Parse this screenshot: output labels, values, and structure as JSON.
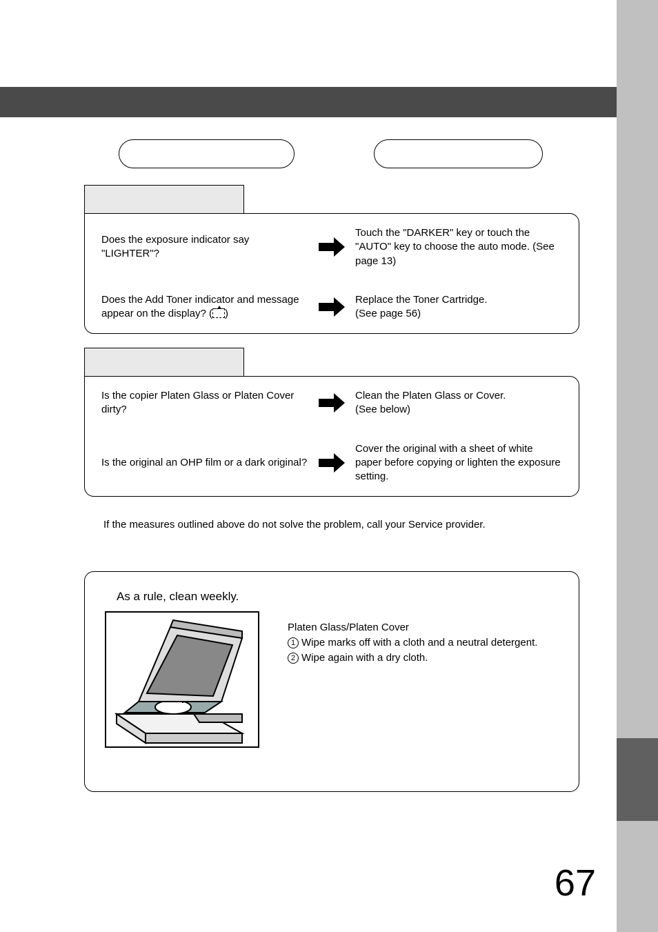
{
  "capsules": {
    "left_label": "",
    "right_label": ""
  },
  "group1": {
    "header": "",
    "rows": [
      {
        "q": "Does the exposure indicator say \"LIGHTER\"?",
        "a": "Touch the \"DARKER\" key or touch the \"AUTO\" key to choose the auto mode. (See page 13)"
      },
      {
        "q_pre": "Does the Add Toner indicator and message appear on the display? (",
        "q_post": ")",
        "a": "Replace the Toner Cartridge.\n(See page 56)"
      }
    ]
  },
  "group2": {
    "header": "",
    "rows": [
      {
        "q": "Is the copier Platen Glass or Platen Cover dirty?",
        "a": "Clean the Platen Glass or Cover.\n(See below)"
      },
      {
        "q": "Is the original an OHP film or a dark original?",
        "a": "Cover the original with a sheet of white paper before copying or lighten the exposure setting."
      }
    ]
  },
  "note": "If the measures outlined above do not solve the problem, call your Service provider.",
  "cleaning": {
    "rule": "As a rule, clean weekly.",
    "subtitle": "Platen Glass/Platen Cover",
    "steps": [
      "Wipe marks off with a cloth and a neutral detergent.",
      "Wipe again with a dry cloth."
    ]
  },
  "page_number": "67"
}
